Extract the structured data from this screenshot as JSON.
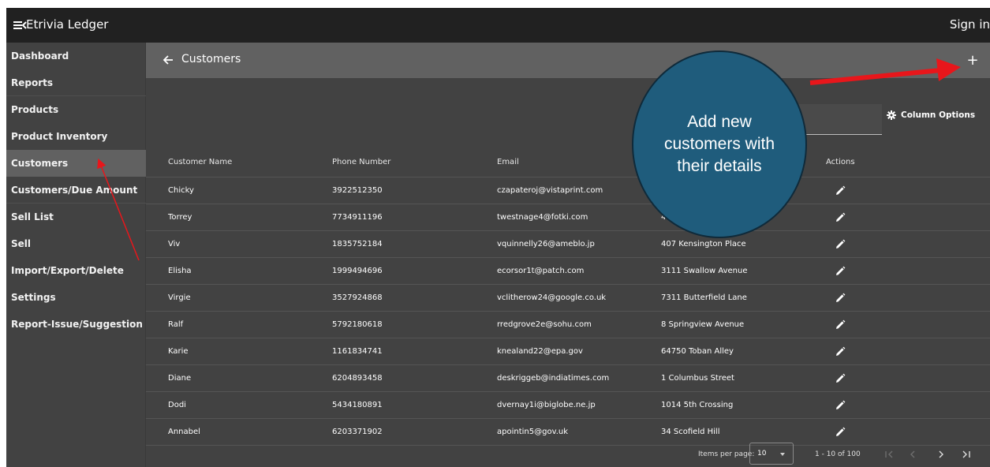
{
  "app": {
    "title": "Etrivia Ledger",
    "sign_in": "Sign in"
  },
  "sidebar": {
    "items": [
      {
        "label": "Dashboard"
      },
      {
        "label": "Reports"
      },
      {
        "label": "Products"
      },
      {
        "label": "Product Inventory"
      },
      {
        "label": "Customers",
        "active": true
      },
      {
        "label": "Customers/Due Amount"
      },
      {
        "label": "Sell List"
      },
      {
        "label": "Sell"
      },
      {
        "label": "Import/Export/Delete"
      },
      {
        "label": "Settings"
      },
      {
        "label": "Report-Issue/Suggestion"
      }
    ]
  },
  "header": {
    "title": "Customers",
    "add_label": "+"
  },
  "toolbar": {
    "column_options": "Column Options"
  },
  "table": {
    "columns": [
      "Customer Name",
      "Phone Number",
      "Email",
      "Address",
      "Actions"
    ],
    "rows": [
      {
        "name": "Chicky",
        "phone": "3922512350",
        "email": "czapateroj@vistaprint.com",
        "address": ""
      },
      {
        "name": "Torrey",
        "phone": "7734911196",
        "email": "twestnage4@fotki.com",
        "address": "40"
      },
      {
        "name": "Viv",
        "phone": "1835752184",
        "email": "vquinnelly26@ameblo.jp",
        "address": "407 Kensington Place"
      },
      {
        "name": "Elisha",
        "phone": "1999494696",
        "email": "ecorsor1t@patch.com",
        "address": "3111 Swallow Avenue"
      },
      {
        "name": "Virgie",
        "phone": "3527924868",
        "email": "vclitherow24@google.co.uk",
        "address": "7311 Butterfield Lane"
      },
      {
        "name": "Ralf",
        "phone": "5792180618",
        "email": "rredgrove2e@sohu.com",
        "address": "8 Springview Avenue"
      },
      {
        "name": "Karie",
        "phone": "1161834741",
        "email": "knealand22@epa.gov",
        "address": "64750 Toban Alley"
      },
      {
        "name": "Diane",
        "phone": "6204893458",
        "email": "deskriggeb@indiatimes.com",
        "address": "1 Columbus Street"
      },
      {
        "name": "Dodi",
        "phone": "5434180891",
        "email": "dvernay1i@biglobe.ne.jp",
        "address": "1014 5th Crossing"
      },
      {
        "name": "Annabel",
        "phone": "6203371902",
        "email": "apointin5@gov.uk",
        "address": "34 Scofield Hill"
      }
    ]
  },
  "paginator": {
    "items_per_page_label": "Items per page:",
    "page_size": "10",
    "range": "1 - 10 of 100"
  },
  "annotation": {
    "text": "Add new customers with their details",
    "callout_color": "#1f5c7c",
    "arrow_color": "#e8161b"
  },
  "colors": {
    "topbar": "#212121",
    "surface": "#424242",
    "header": "#616161",
    "active_item": "#616161"
  }
}
